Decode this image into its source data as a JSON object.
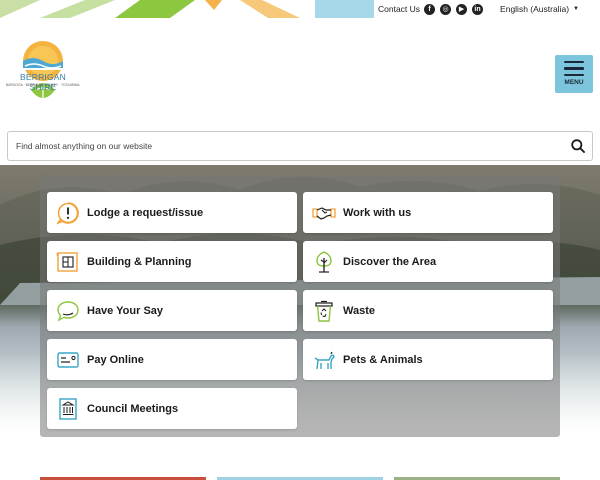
{
  "utility": {
    "contact_label": "Contact Us",
    "social": [
      {
        "name": "facebook-icon",
        "glyph": "f"
      },
      {
        "name": "instagram-icon",
        "glyph": "◎"
      },
      {
        "name": "youtube-icon",
        "glyph": "▶"
      },
      {
        "name": "linkedin-icon",
        "glyph": "in"
      }
    ],
    "language": "English (Australia)"
  },
  "logo": {
    "name": "BERRIGAN SHIRE",
    "towns": "BAROOGA · BERRIGAN · FINLEY · TOCUMWAL"
  },
  "menu": {
    "label": "MENU"
  },
  "search": {
    "placeholder": "Find almost anything on our website",
    "value": ""
  },
  "tiles": [
    {
      "label": "Lodge a request/issue",
      "icon": "alert-icon"
    },
    {
      "label": "Work with us",
      "icon": "handshake-icon"
    },
    {
      "label": "Building & Planning",
      "icon": "blueprint-icon"
    },
    {
      "label": "Discover the Area",
      "icon": "tree-icon"
    },
    {
      "label": "Have Your Say",
      "icon": "chat-icon"
    },
    {
      "label": "Waste",
      "icon": "recycle-bin-icon"
    },
    {
      "label": "Pay Online",
      "icon": "payment-card-icon"
    },
    {
      "label": "Pets & Animals",
      "icon": "dog-icon"
    },
    {
      "label": "Council Meetings",
      "icon": "council-building-icon"
    }
  ],
  "colors": {
    "accent_orange": "#f2a33a",
    "accent_blue": "#7cc5dd",
    "accent_green": "#8dc63f",
    "icon_teal": "#3aa6c6"
  }
}
